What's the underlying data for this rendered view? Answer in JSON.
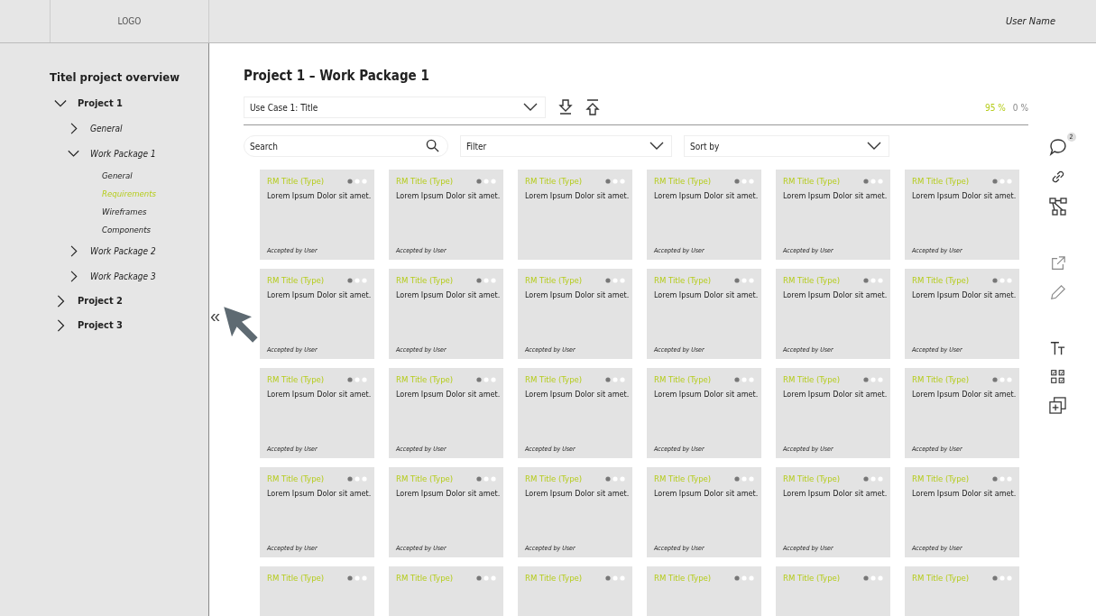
{
  "header": {
    "logo": "LOGO",
    "user": "User Name"
  },
  "sidebar": {
    "title": "Titel project overview",
    "collapse": "«",
    "tree": [
      {
        "label": "Project 1",
        "expanded": true,
        "children": [
          {
            "label": "General",
            "expanded": false
          },
          {
            "label": "Work Package 1",
            "expanded": true,
            "children": [
              {
                "label": "General",
                "selected": false
              },
              {
                "label": "Requirements",
                "selected": true
              },
              {
                "label": "Wireframes",
                "selected": false
              },
              {
                "label": "Components",
                "selected": false
              }
            ]
          },
          {
            "label": "Work Package 2",
            "expanded": false
          },
          {
            "label": "Work Package 3",
            "expanded": false
          }
        ]
      },
      {
        "label": "Project 2",
        "expanded": false
      },
      {
        "label": "Project 3",
        "expanded": false
      }
    ]
  },
  "main": {
    "title": "Project 1 – Work Package 1",
    "use_case": "Use Case 1: Title",
    "progress": [
      "95 %",
      "0 %"
    ],
    "search": {
      "placeholder": "Search"
    },
    "filter": {
      "placeholder": "Filter"
    },
    "sort": {
      "placeholder": "Sort by"
    },
    "comment_count": "2"
  },
  "cards": [
    {
      "title": "RM Title (Type)",
      "text": "Lorem Ipsum Dolor sit amet.",
      "footer": "Accepted by User"
    },
    {
      "title": "RM Title (Type)",
      "text": "Lorem Ipsum Dolor sit amet.",
      "footer": "Accepted by User"
    },
    {
      "title": "RM Title (Type)",
      "text": "Lorem Ipsum Dolor sit amet."
    },
    {
      "title": "RM Title (Type)",
      "text": "Lorem Ipsum Dolor sit amet.",
      "footer": "Accepted by User"
    },
    {
      "title": "RM Title (Type)",
      "text": "Lorem Ipsum Dolor sit amet.",
      "footer": "Accepted by User"
    },
    {
      "title": "RM Title (Type)",
      "text": "Lorem Ipsum Dolor sit amet.",
      "footer": "Accepted by User"
    },
    {
      "title": "RM Title (Type)",
      "text": "Lorem Ipsum Dolor sit amet.",
      "footer": "Accepted by User"
    },
    {
      "title": "RM Title (Type)",
      "text": "Lorem Ipsum Dolor sit amet.",
      "footer": "Accepted by User"
    },
    {
      "title": "RM Title (Type)",
      "text": "Lorem Ipsum Dolor sit amet.",
      "footer": "Accepted by User"
    },
    {
      "title": "RM Title (Type)",
      "text": "Lorem Ipsum Dolor sit amet.",
      "footer": "Accepted by User"
    },
    {
      "title": "RM Title (Type)",
      "text": "Lorem Ipsum Dolor sit amet.",
      "footer": "Accepted by User"
    },
    {
      "title": "RM Title (Type)",
      "text": "Lorem Ipsum Dolor sit amet.",
      "footer": "Accepted by User"
    },
    {
      "title": "RM Title (Type)",
      "text": "Lorem Ipsum Dolor sit amet.",
      "footer": "Accepted by User"
    },
    {
      "title": "RM Title (Type)",
      "text": "Lorem Ipsum Dolor sit amet.",
      "footer": "Accepted by User"
    },
    {
      "title": "RM Title (Type)",
      "text": "Lorem Ipsum Dolor sit amet.",
      "footer": "Accepted by User"
    },
    {
      "title": "RM Title (Type)",
      "text": "Lorem Ipsum Dolor sit amet.",
      "footer": "Accepted by User"
    },
    {
      "title": "RM Title (Type)",
      "text": "Lorem Ipsum Dolor sit amet.",
      "footer": "Accepted by User"
    },
    {
      "title": "RM Title (Type)",
      "text": "Lorem Ipsum Dolor sit amet.",
      "footer": "Accepted by User"
    },
    {
      "title": "RM Title (Type)",
      "text": "Lorem Ipsum Dolor sit amet.",
      "footer": "Accepted by User"
    },
    {
      "title": "RM Title (Type)",
      "text": "Lorem Ipsum Dolor sit amet.",
      "footer": "Accepted by User"
    },
    {
      "title": "RM Title (Type)",
      "text": "Lorem Ipsum Dolor sit amet.",
      "footer": "Accepted by User"
    },
    {
      "title": "RM Title (Type)",
      "text": "Lorem Ipsum Dolor sit amet.",
      "footer": "Accepted by User"
    },
    {
      "title": "RM Title (Type)",
      "text": "Lorem Ipsum Dolor sit amet.",
      "footer": "Accepted by User"
    },
    {
      "title": "RM Title (Type)",
      "text": "Lorem Ipsum Dolor sit amet.",
      "footer": "Accepted by User"
    },
    {
      "title": "RM Title (Type)"
    },
    {
      "title": "RM Title (Type)"
    },
    {
      "title": "RM Title (Type)"
    },
    {
      "title": "RM Title (Type)"
    },
    {
      "title": "RM Title (Type)"
    },
    {
      "title": "RM Title (Type)"
    }
  ]
}
